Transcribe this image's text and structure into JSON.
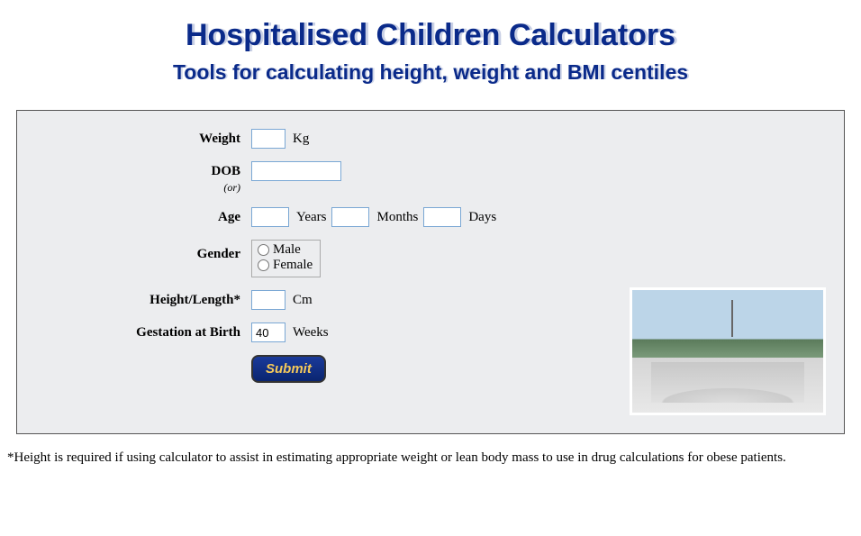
{
  "header": {
    "title": "Hospitalised Children Calculators",
    "subtitle": "Tools for calculating height, weight and BMI centiles"
  },
  "form": {
    "weight": {
      "label": "Weight",
      "value": "",
      "unit": "Kg"
    },
    "dob": {
      "label": "DOB",
      "or": "(or)",
      "value": ""
    },
    "age": {
      "label": "Age",
      "years": {
        "value": "",
        "unit": "Years"
      },
      "months": {
        "value": "",
        "unit": "Months"
      },
      "days": {
        "value": "",
        "unit": "Days"
      }
    },
    "gender": {
      "label": "Gender",
      "options": {
        "male": "Male",
        "female": "Female"
      }
    },
    "height": {
      "label": "Height/Length*",
      "value": "",
      "unit": "Cm"
    },
    "gestation": {
      "label": "Gestation at Birth",
      "value": "40",
      "unit": "Weeks"
    },
    "submit": "Submit"
  },
  "footnote": "*Height is required if using calculator to assist in estimating appropriate weight or lean body mass to use in drug calculations for obese patients."
}
